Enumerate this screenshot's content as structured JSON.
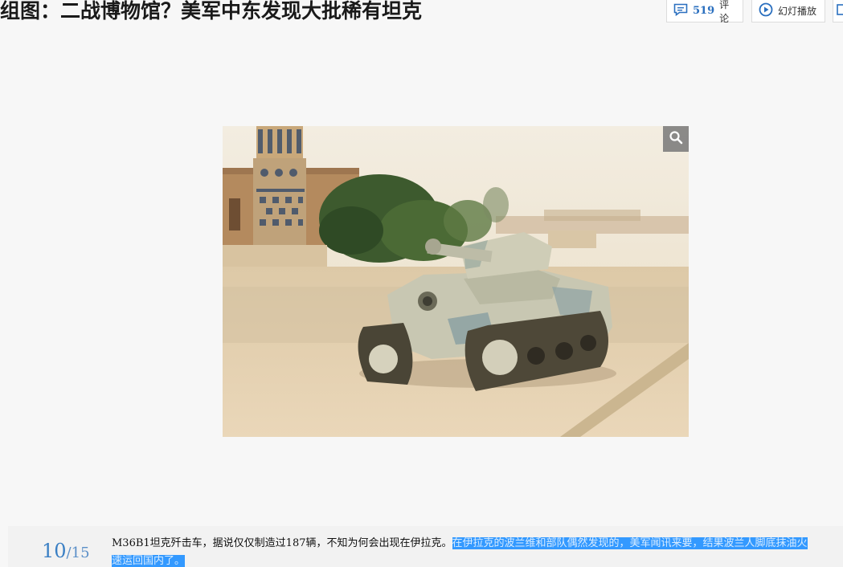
{
  "header": {
    "title": "组图：二战博物馆？美军中东发现大批稀有坦克"
  },
  "toolbar": {
    "comment_count": "519",
    "comment_label": "评论",
    "slideshow_label": "幻灯播放"
  },
  "gallery": {
    "current": "10",
    "total": "/15",
    "caption_plain": "M36B1坦克歼击车，据说仅仅制造过187辆，不知为何会出现在伊拉克。",
    "caption_selected_line1": "在伊拉克的波兰维和部队偶然发现的，美军闻讯来要，结果波兰人脚底抹油火",
    "caption_selected_line2": "速运回国内了。"
  },
  "icons": {
    "comment": "comment-bubble-icon",
    "slideshow": "play-circle-icon",
    "zoom": "magnifier-icon"
  },
  "colors": {
    "accent_blue": "#2a6fbf",
    "selection": "#3399ff"
  }
}
